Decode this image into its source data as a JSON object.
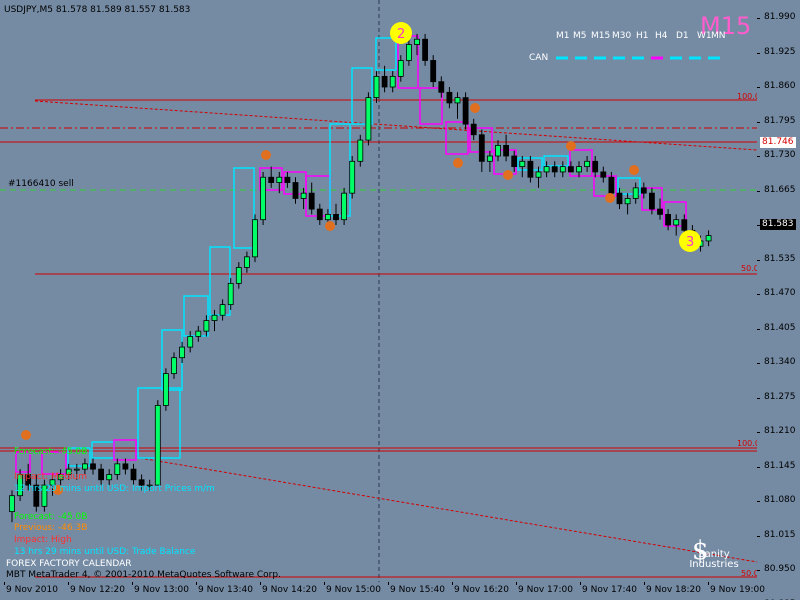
{
  "symbol_info": "USDJPY,M5  81.578 81.589 81.557 81.583",
  "timeframe_big": "M15",
  "timeframes": [
    "M1",
    "M5",
    "M15",
    "M30",
    "H1",
    "H4",
    "D1",
    "W1",
    "MN"
  ],
  "can_label": "CAN",
  "order_label": "#1166410 sell",
  "price_levels": [
    "81.990",
    "81.925",
    "81.860",
    "81.795",
    "81.730",
    "81.665",
    "81.600",
    "81.535",
    "81.470",
    "81.405",
    "81.340",
    "81.275",
    "81.210",
    "81.145",
    "81.080",
    "81.015",
    "80.950",
    "80.885"
  ],
  "current_price": "81.583",
  "line_price": "81.746",
  "fib_labels": {
    "top": "100.0",
    "mid": "50.0",
    "low": "100.0",
    "bottom": "50.0"
  },
  "time_labels": [
    "9 Nov 2010",
    "9 Nov 12:20",
    "9 Nov 13:00",
    "9 Nov 13:40",
    "9 Nov 14:20",
    "9 Nov 15:00",
    "9 Nov 15:40",
    "9 Nov 16:20",
    "9 Nov 17:00",
    "9 Nov 17:40",
    "9 Nov 18:20",
    "9 Nov 19:00"
  ],
  "news_upper": {
    "forecast": "Forecast: -45.0B",
    "impact": "Impact: Medium",
    "countdown": "12 hrs 29 mins until USD: Import Prices m/m"
  },
  "news_lower": {
    "forecast": "Forecast: -45.0B",
    "previous": "Previous: -46.3B",
    "impact": "Impact: High",
    "countdown": "13 hrs 29 mins until USD: Trade Balance"
  },
  "calendar_title": "FOREX FACTORY CALENDAR",
  "copyright": "MBT MetaTrader 4, © 2001-2010 MetaQuotes Software Corp.",
  "logo_text": "Sanity Industries",
  "marker_labels": {
    "top": "2",
    "bottom": "3"
  },
  "colors": {
    "bg": "#758ba4",
    "cyan": "#00e5ff",
    "magenta": "#ff00ff",
    "red": "#d40000",
    "green_dash": "#2fd02f",
    "yellow": "#ffff00",
    "orange": "#e07020"
  },
  "chart_data": {
    "type": "candlestick",
    "candles": [
      [
        81.06,
        81.1,
        81.04,
        81.09
      ],
      [
        81.09,
        81.14,
        81.08,
        81.13
      ],
      [
        81.13,
        81.15,
        81.1,
        81.11
      ],
      [
        81.11,
        81.13,
        81.06,
        81.07
      ],
      [
        81.07,
        81.12,
        81.06,
        81.11
      ],
      [
        81.11,
        81.13,
        81.09,
        81.12
      ],
      [
        81.12,
        81.14,
        81.11,
        81.13
      ],
      [
        81.13,
        81.15,
        81.12,
        81.14
      ],
      [
        81.14,
        81.15,
        81.12,
        81.14
      ],
      [
        81.14,
        81.16,
        81.13,
        81.15
      ],
      [
        81.15,
        81.16,
        81.13,
        81.14
      ],
      [
        81.14,
        81.15,
        81.11,
        81.12
      ],
      [
        81.12,
        81.14,
        81.11,
        81.13
      ],
      [
        81.13,
        81.16,
        81.12,
        81.15
      ],
      [
        81.15,
        81.16,
        81.13,
        81.14
      ],
      [
        81.14,
        81.15,
        81.11,
        81.12
      ],
      [
        81.12,
        81.13,
        81.1,
        81.11
      ],
      [
        81.11,
        81.12,
        81.1,
        81.11
      ],
      [
        81.11,
        81.27,
        81.11,
        81.26
      ],
      [
        81.26,
        81.33,
        81.25,
        81.32
      ],
      [
        81.32,
        81.36,
        81.31,
        81.35
      ],
      [
        81.35,
        81.38,
        81.34,
        81.37
      ],
      [
        81.37,
        81.4,
        81.36,
        81.39
      ],
      [
        81.39,
        81.41,
        81.38,
        81.4
      ],
      [
        81.4,
        81.43,
        81.39,
        81.42
      ],
      [
        81.42,
        81.44,
        81.4,
        81.43
      ],
      [
        81.43,
        81.46,
        81.42,
        81.45
      ],
      [
        81.45,
        81.5,
        81.44,
        81.49
      ],
      [
        81.49,
        81.53,
        81.48,
        81.52
      ],
      [
        81.52,
        81.55,
        81.51,
        81.54
      ],
      [
        81.54,
        81.62,
        81.53,
        81.61
      ],
      [
        81.61,
        81.7,
        81.6,
        81.69
      ],
      [
        81.69,
        81.71,
        81.67,
        81.68
      ],
      [
        81.68,
        81.7,
        81.66,
        81.69
      ],
      [
        81.69,
        81.7,
        81.67,
        81.68
      ],
      [
        81.68,
        81.69,
        81.64,
        81.65
      ],
      [
        81.65,
        81.67,
        81.63,
        81.66
      ],
      [
        81.66,
        81.68,
        81.62,
        81.63
      ],
      [
        81.63,
        81.64,
        81.6,
        81.61
      ],
      [
        81.61,
        81.63,
        81.59,
        81.62
      ],
      [
        81.62,
        81.64,
        81.6,
        81.61
      ],
      [
        81.61,
        81.67,
        81.6,
        81.66
      ],
      [
        81.66,
        81.73,
        81.65,
        81.72
      ],
      [
        81.72,
        81.77,
        81.71,
        81.76
      ],
      [
        81.76,
        81.85,
        81.75,
        81.84
      ],
      [
        81.84,
        81.89,
        81.83,
        81.88
      ],
      [
        81.88,
        81.9,
        81.85,
        81.86
      ],
      [
        81.86,
        81.89,
        81.85,
        81.88
      ],
      [
        81.88,
        81.92,
        81.87,
        81.91
      ],
      [
        81.91,
        81.95,
        81.9,
        81.94
      ],
      [
        81.94,
        81.96,
        81.92,
        81.95
      ],
      [
        81.95,
        81.96,
        81.9,
        81.91
      ],
      [
        81.91,
        81.92,
        81.86,
        81.87
      ],
      [
        81.87,
        81.88,
        81.84,
        81.85
      ],
      [
        81.85,
        81.86,
        81.82,
        81.83
      ],
      [
        81.83,
        81.85,
        81.8,
        81.84
      ],
      [
        81.84,
        81.85,
        81.78,
        81.79
      ],
      [
        81.79,
        81.8,
        81.76,
        81.77
      ],
      [
        81.77,
        81.78,
        81.7,
        81.72
      ],
      [
        81.72,
        81.74,
        81.7,
        81.73
      ],
      [
        81.73,
        81.76,
        81.72,
        81.75
      ],
      [
        81.75,
        81.77,
        81.72,
        81.73
      ],
      [
        81.73,
        81.74,
        81.7,
        81.71
      ],
      [
        81.71,
        81.73,
        81.69,
        81.72
      ],
      [
        81.72,
        81.73,
        81.68,
        81.69
      ],
      [
        81.69,
        81.71,
        81.67,
        81.7
      ],
      [
        81.7,
        81.72,
        81.69,
        81.71
      ],
      [
        81.71,
        81.72,
        81.69,
        81.7
      ],
      [
        81.7,
        81.72,
        81.69,
        81.71
      ],
      [
        81.71,
        81.72,
        81.7,
        81.7
      ],
      [
        81.7,
        81.72,
        81.69,
        81.71
      ],
      [
        81.71,
        81.73,
        81.7,
        81.72
      ],
      [
        81.72,
        81.73,
        81.69,
        81.7
      ],
      [
        81.7,
        81.71,
        81.68,
        81.69
      ],
      [
        81.69,
        81.7,
        81.65,
        81.66
      ],
      [
        81.66,
        81.67,
        81.63,
        81.64
      ],
      [
        81.64,
        81.66,
        81.62,
        81.65
      ],
      [
        81.65,
        81.68,
        81.64,
        81.67
      ],
      [
        81.67,
        81.68,
        81.65,
        81.66
      ],
      [
        81.66,
        81.67,
        81.62,
        81.63
      ],
      [
        81.63,
        81.65,
        81.61,
        81.62
      ],
      [
        81.62,
        81.63,
        81.59,
        81.6
      ],
      [
        81.6,
        81.62,
        81.58,
        81.61
      ],
      [
        81.61,
        81.62,
        81.58,
        81.59
      ],
      [
        81.59,
        81.6,
        81.55,
        81.56
      ],
      [
        81.56,
        81.58,
        81.55,
        81.57
      ],
      [
        81.57,
        81.59,
        81.56,
        81.58
      ]
    ]
  }
}
